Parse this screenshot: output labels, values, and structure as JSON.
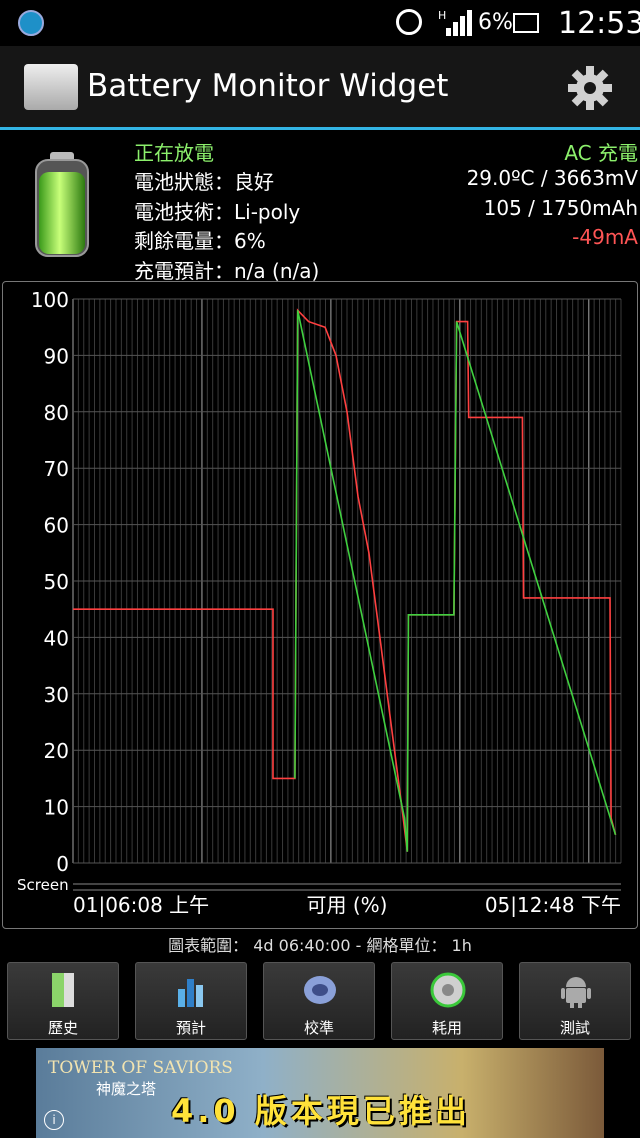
{
  "status_bar": {
    "network": "H",
    "battery_percent": "6%",
    "time": "12:53"
  },
  "app": {
    "title": "Battery Monitor Widget"
  },
  "info": {
    "state": "正在放電",
    "charge_mode": "AC 充電",
    "health": "電池狀態：良好",
    "technology": "電池技術：Li-poly",
    "remaining": "剩餘電量：6%",
    "estimate": "充電預計：n/a (n/a)",
    "temp_voltage": "29.0ºC / 3663mV",
    "capacity": "105 / 1750mAh",
    "current": "-49mA"
  },
  "chart_data": {
    "type": "line",
    "ylim": [
      0,
      100
    ],
    "y_ticks": [
      "100",
      "90",
      "80",
      "70",
      "60",
      "50",
      "40",
      "30",
      "20",
      "10",
      "0"
    ],
    "screen_label": "Screen",
    "x_start_label": "01|06:08 上午",
    "x_center_label": "可用 (%)",
    "x_end_label": "05|12:48 下午",
    "grid": true,
    "series": [
      {
        "color": "#ff4040",
        "points": [
          [
            0,
            45
          ],
          [
            0.365,
            45
          ],
          [
            0.365,
            15
          ],
          [
            0.405,
            15
          ],
          [
            0.41,
            98
          ],
          [
            0.43,
            96
          ],
          [
            0.46,
            95
          ],
          [
            0.48,
            90
          ],
          [
            0.5,
            80
          ],
          [
            0.52,
            65
          ],
          [
            0.54,
            55
          ],
          [
            0.56,
            40
          ],
          [
            0.58,
            25
          ],
          [
            0.6,
            10
          ],
          [
            0.61,
            2
          ],
          [
            0.612,
            44
          ],
          [
            0.695,
            44
          ],
          [
            0.7,
            96
          ],
          [
            0.72,
            96
          ],
          [
            0.722,
            79
          ],
          [
            0.82,
            79
          ],
          [
            0.822,
            47
          ],
          [
            0.98,
            47
          ],
          [
            0.982,
            8
          ],
          [
            0.99,
            5
          ]
        ]
      },
      {
        "color": "#40d040",
        "points": [
          [
            0.405,
            15
          ],
          [
            0.41,
            98
          ],
          [
            0.605,
            8
          ],
          [
            0.61,
            2
          ],
          [
            0.612,
            44
          ],
          [
            0.695,
            44
          ],
          [
            0.7,
            96
          ],
          [
            0.99,
            5
          ]
        ]
      }
    ]
  },
  "range_info": "圖表範圍： 4d 06:40:00 - 網格單位： 1h",
  "toolbar": {
    "buttons": [
      "歷史",
      "預計",
      "校準",
      "耗用",
      "測試"
    ]
  },
  "ad": {
    "brand": "TOWER OF SAVIORS",
    "brand_sub": "神魔之塔",
    "headline": "4.0 版本現已推出"
  },
  "colors": {
    "accent": "#33b5e5",
    "green": "#8cf06c",
    "red": "#ff5555"
  }
}
